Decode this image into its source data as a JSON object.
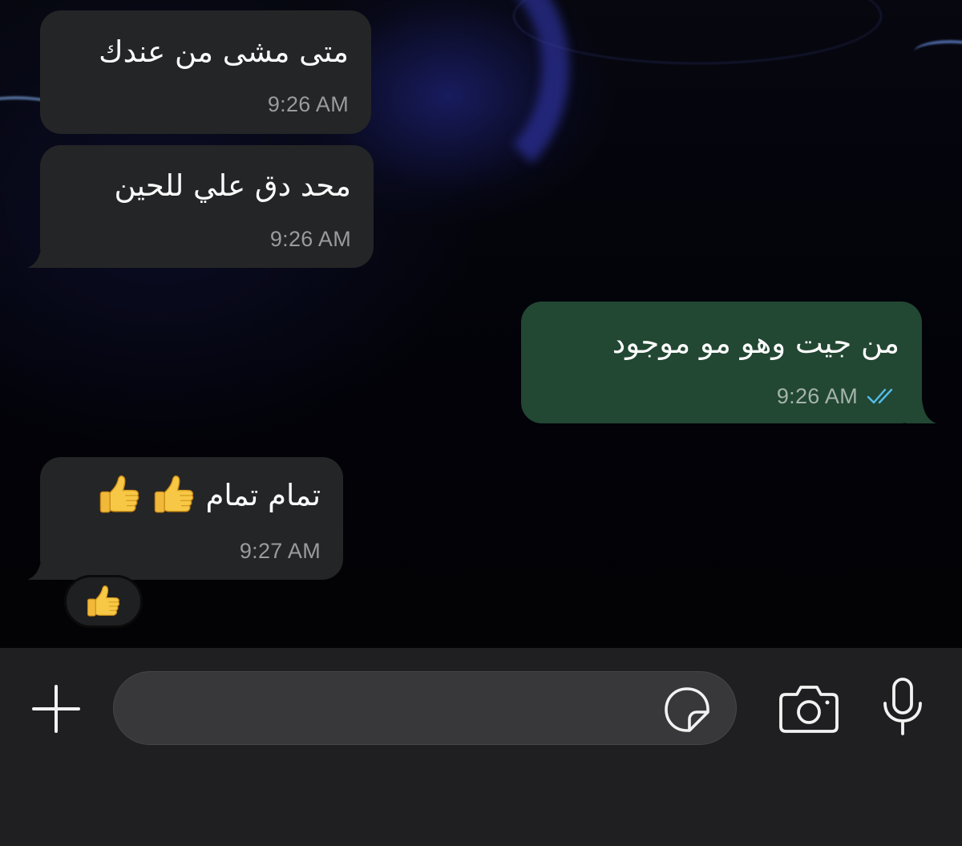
{
  "messages": [
    {
      "direction": "incoming",
      "text": "متى مشى من عندك",
      "time": "9:26 AM"
    },
    {
      "direction": "incoming",
      "text": "محد دق علي للحين",
      "time": "9:26 AM"
    },
    {
      "direction": "outgoing",
      "text": "من جيت وهو مو موجود",
      "time": "9:26 AM",
      "status": "read",
      "status_icon": "double-check-icon"
    },
    {
      "direction": "incoming",
      "text": "تمام تمام",
      "emoji": [
        "thumbs-up-emoji",
        "thumbs-up-emoji"
      ],
      "time": "9:27 AM",
      "reaction": "thumbs-up-emoji"
    }
  ],
  "composer": {
    "placeholder": "",
    "icons": [
      "plus-icon",
      "sticker-icon",
      "camera-icon",
      "microphone-icon"
    ]
  },
  "colors": {
    "incoming_bubble": "#242526",
    "outgoing_bubble": "#224733",
    "read_check": "#53bdeb",
    "composer_bg": "#1f1f21"
  }
}
